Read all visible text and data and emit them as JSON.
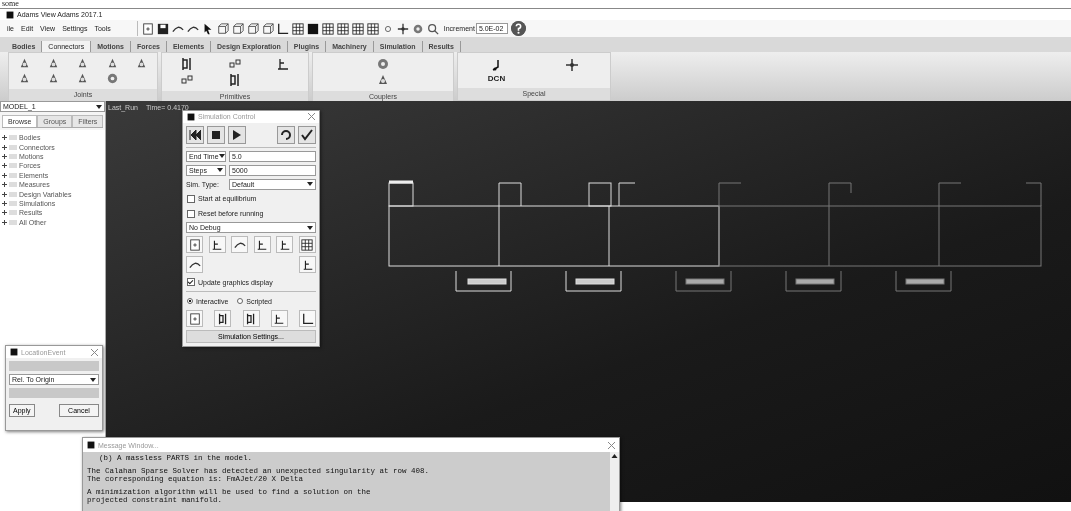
{
  "header_fragment": "some",
  "window": {
    "title": "Adams View Adams 2017.1"
  },
  "menu": [
    "ile",
    "Edit",
    "View",
    "Settings",
    "Tools"
  ],
  "toolbar": {
    "increment_label": "Increment",
    "increment_value": "5.0E-02"
  },
  "tabs": [
    {
      "label": "Bodies",
      "selected": false
    },
    {
      "label": "Connectors",
      "selected": true
    },
    {
      "label": "Motions",
      "selected": false
    },
    {
      "label": "Forces",
      "selected": false
    },
    {
      "label": "Elements",
      "selected": false
    },
    {
      "label": "Design Exploration",
      "selected": false
    },
    {
      "label": "Plugins",
      "selected": false
    },
    {
      "label": "Machinery",
      "selected": false
    },
    {
      "label": "Simulation",
      "selected": false
    },
    {
      "label": "Results",
      "selected": false
    }
  ],
  "ribbon": {
    "groups": [
      {
        "kind": "joints",
        "label": "Joints"
      },
      {
        "kind": "primitives",
        "label": "Primitives"
      },
      {
        "kind": "couplers",
        "label": "Couplers"
      },
      {
        "kind": "special",
        "label": "Special",
        "tool_text": "DCN"
      }
    ]
  },
  "browser": {
    "model": "MODEL_1",
    "tabs": [
      {
        "label": "Browse",
        "selected": true
      },
      {
        "label": "Groups",
        "selected": false
      },
      {
        "label": "Filters",
        "selected": false
      }
    ],
    "tree": [
      {
        "label": "Bodies",
        "expanded": false
      },
      {
        "label": "Connectors",
        "expanded": false
      },
      {
        "label": "Motions",
        "expanded": false
      },
      {
        "label": "Forces",
        "expanded": false
      },
      {
        "label": "Elements",
        "expanded": false
      },
      {
        "label": "Measures",
        "expanded": false
      },
      {
        "label": "Design Variables",
        "expanded": false
      },
      {
        "label": "Simulations",
        "expanded": false
      },
      {
        "label": "Results",
        "expanded": false
      },
      {
        "label": "All Other",
        "expanded": false
      }
    ]
  },
  "canvas": {
    "run_label": "Last_Run",
    "time_label": "Time= 0.4170"
  },
  "simulation_control": {
    "title": "Simulation Control",
    "end_mode": "End Time",
    "end_value": "5.0",
    "steps_mode": "Steps",
    "steps_value": "5000",
    "sim_type_label": "Sim. Type:",
    "sim_type": "Default",
    "options": [
      {
        "label": "Start at equilibrium",
        "checked": false
      },
      {
        "label": "Reset before running",
        "checked": false
      }
    ],
    "debug": "No Debug",
    "update_graphics": {
      "label": "Update graphics display",
      "checked": true
    },
    "modes": [
      {
        "label": "Interactive",
        "selected": true
      },
      {
        "label": "Scripted",
        "selected": false
      }
    ],
    "settings_button": "Simulation Settings..."
  },
  "location_event": {
    "title": "LocationEvent",
    "reference": "Rel. To Origin",
    "buttons": [
      "Apply",
      "Cancel"
    ]
  },
  "message_window": {
    "title": "Message Window...",
    "blocks": [
      {
        "indented": true,
        "lines": [
          "(b) A massless PARTS in the model."
        ]
      },
      {
        "indented": false,
        "lines": [
          "The Calahan Sparse Solver has detected an unexpected singularity at row 408.",
          "The corresponding equation is: FmAJet/20 X Delta"
        ]
      },
      {
        "indented": false,
        "lines": [
          "A minimization algorithm will be used to find a solution on the",
          "projected constraint manifold."
        ]
      }
    ]
  }
}
